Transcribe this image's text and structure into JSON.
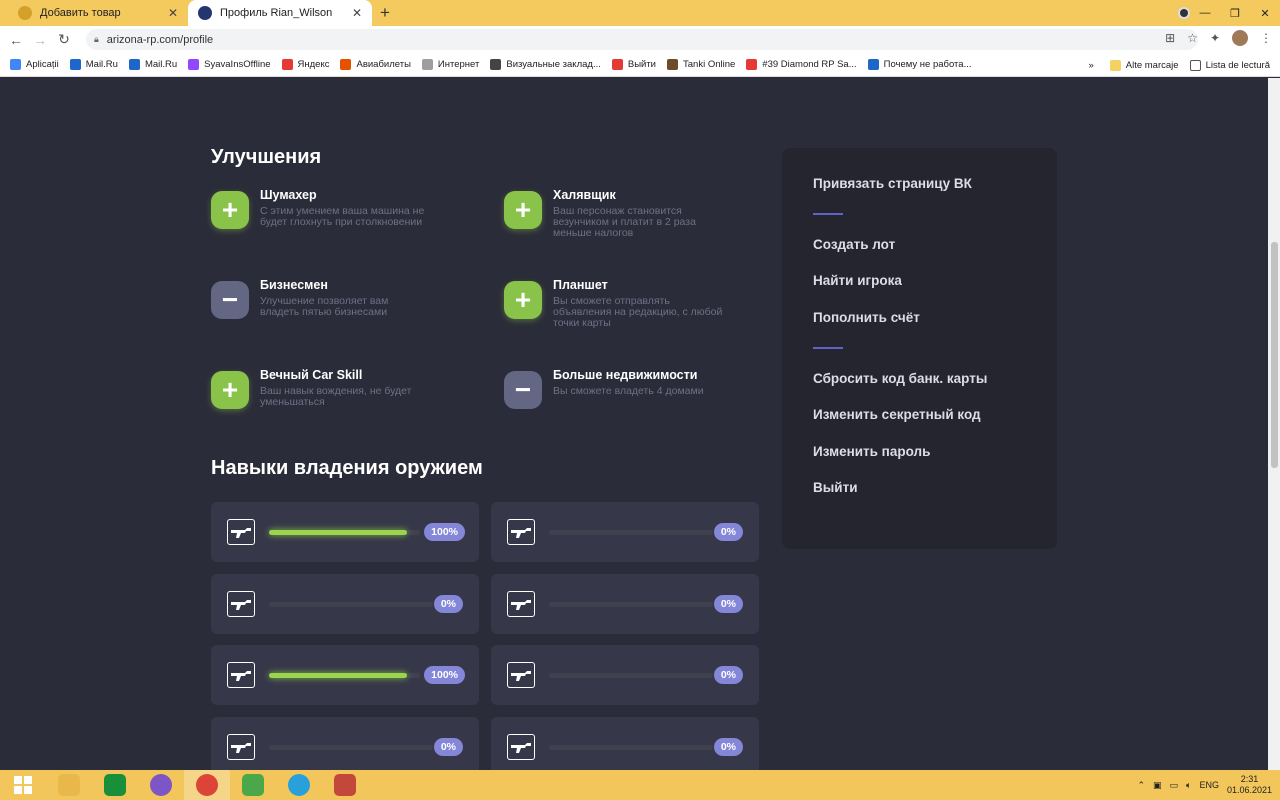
{
  "browser": {
    "tabs": [
      {
        "title": "Добавить товар",
        "active": false,
        "favicon_color": "#d4a02a"
      },
      {
        "title": "Профиль Rian_Wilson",
        "active": true,
        "favicon_color": "#253570"
      }
    ],
    "url": "arizona-rp.com/profile",
    "bookmarks": [
      {
        "label": "Aplicații",
        "icon_color": "#4285f4"
      },
      {
        "label": "Mail.Ru",
        "icon_color": "#1e66c9"
      },
      {
        "label": "Mail.Ru",
        "icon_color": "#1e66c9"
      },
      {
        "label": "SyavaInsOffline",
        "icon_color": "#9146ff"
      },
      {
        "label": "Яндекс",
        "icon_color": "#e53935"
      },
      {
        "label": "Авиабилеты",
        "icon_color": "#e65100"
      },
      {
        "label": "Интернет",
        "icon_color": "#9e9e9e"
      },
      {
        "label": "Визуальные заклад...",
        "icon_color": "#444444"
      },
      {
        "label": "Выйти",
        "icon_color": "#e53935"
      },
      {
        "label": "Tanki Online",
        "icon_color": "#6d4c2a"
      },
      {
        "label": "#39 Diamond RP Sa...",
        "icon_color": "#e53935"
      },
      {
        "label": "Почему не работа...",
        "icon_color": "#1e66c9"
      }
    ],
    "bookmarks_overflow": "»",
    "other_bookmarks": "Alte marcaje",
    "reading_list": "Lista de lectură"
  },
  "upgrades": {
    "title": "Улучшения",
    "items": [
      {
        "name": "Шумахер",
        "desc": "С этим умением ваша машина не будет глохнуть при столкновении",
        "state": "plus"
      },
      {
        "name": "Халявщик",
        "desc": "Ваш персонаж становится везунчиком и платит в 2 раза меньше налогов",
        "state": "plus"
      },
      {
        "name": "Бизнесмен",
        "desc": "Улучшение позволяет вам владеть пятью бизнесами",
        "state": "minus"
      },
      {
        "name": "Планшет",
        "desc": "Вы сможете отправлять объявления на редакцию, с любой точки карты",
        "state": "plus"
      },
      {
        "name": "Вечный Car Skill",
        "desc": "Ваш навык вождения, не будет уменьшаться",
        "state": "plus"
      },
      {
        "name": "Больше недвижимости",
        "desc": "Вы сможете владеть 4 домами",
        "state": "minus"
      }
    ]
  },
  "weapons": {
    "title": "Навыки владения оружием",
    "items": [
      {
        "icon": "assault-rifle-icon",
        "progress": 100,
        "label": "100%"
      },
      {
        "icon": "rifle-icon",
        "progress": 0,
        "label": "0%"
      },
      {
        "icon": "pistol-icon",
        "progress": 0,
        "label": "0%"
      },
      {
        "icon": "silenced-pistol-icon",
        "progress": 0,
        "label": "0%"
      },
      {
        "icon": "desert-eagle-icon",
        "progress": 100,
        "label": "100%"
      },
      {
        "icon": "shotgun-icon",
        "progress": 0,
        "label": "0%"
      },
      {
        "icon": "smg-icon",
        "progress": 0,
        "label": "0%"
      },
      {
        "icon": "sniper-rifle-icon",
        "progress": 0,
        "label": "0%"
      }
    ]
  },
  "sidebar": {
    "links": [
      "Привязать страницу ВК",
      "Создать лот",
      "Найти игрока",
      "Пополнить счёт",
      "Сбросить код банк. карты",
      "Изменить секретный код",
      "Изменить пароль",
      "Выйти"
    ]
  },
  "taskbar": {
    "apps": [
      {
        "name": "file-explorer-icon",
        "color": "#e8b84a"
      },
      {
        "name": "store-icon",
        "color": "#1a8f3a"
      },
      {
        "name": "viber-icon",
        "color": "#7d55c7"
      },
      {
        "name": "chrome-icon",
        "color": "#db4437"
      },
      {
        "name": "utorrent-icon",
        "color": "#4aa74a"
      },
      {
        "name": "telegram-icon",
        "color": "#2aa0da"
      },
      {
        "name": "game-launcher-icon",
        "color": "#c3473a"
      }
    ],
    "lang": "ENG",
    "time": "2:31",
    "date": "01.06.2021"
  },
  "colors": {
    "accent": "#8ac34a",
    "badge": "#8486d8",
    "bg": "#2b2c39",
    "card": "#363749",
    "sidebar": "#24252f"
  }
}
